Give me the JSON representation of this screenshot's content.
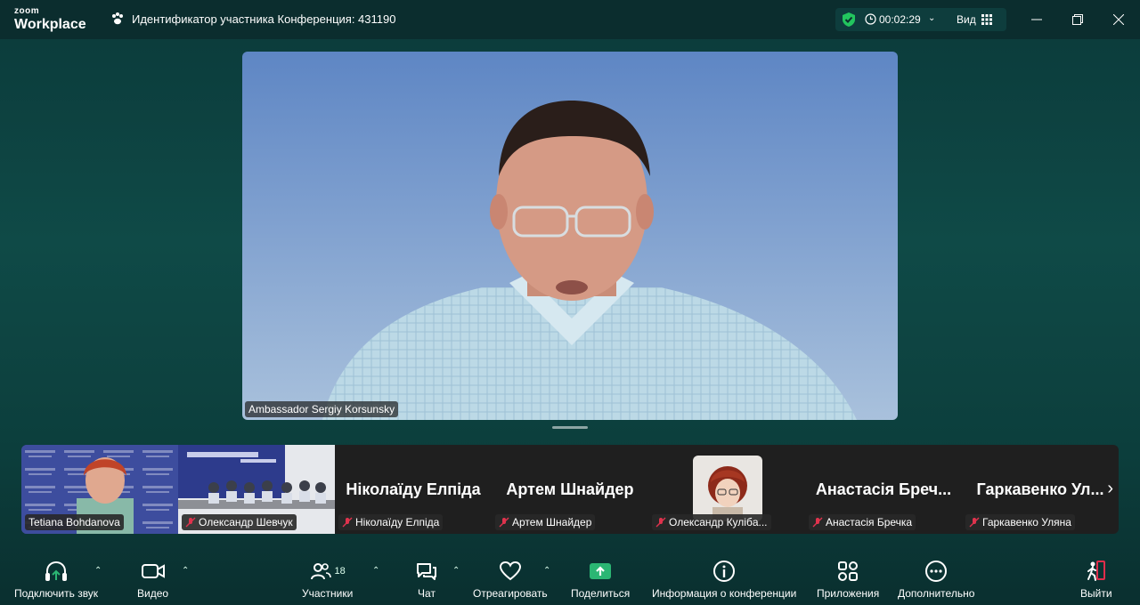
{
  "app": {
    "brand_small": "zoom",
    "brand_large": "Workplace"
  },
  "header": {
    "meeting_id_text": "Идентификатор участника Конференция: 431190",
    "timer": "00:02:29",
    "view_label": "Вид"
  },
  "speaker": {
    "name": "Ambassador Sergiy Korsunsky"
  },
  "participants": [
    {
      "name": "Tetiana Bohdanova",
      "big_name": "",
      "muted": false,
      "type": "video"
    },
    {
      "name": "Олександр Шевчук",
      "big_name": "",
      "muted": true,
      "type": "video"
    },
    {
      "name": "Ніколаїду Елпіда",
      "big_name": "Ніколаїду Елпіда",
      "muted": true,
      "type": "name"
    },
    {
      "name": "Артем Шнайдер",
      "big_name": "Артем Шнайдер",
      "muted": true,
      "type": "name"
    },
    {
      "name": "Олександр Кулібa...",
      "big_name": "",
      "muted": true,
      "type": "avatar"
    },
    {
      "name": "Анастасія Бречка",
      "big_name": "Анастасія Бреч...",
      "muted": true,
      "type": "name"
    },
    {
      "name": "Гаркавенко Уляна",
      "big_name": "Гаркавенко Ул...",
      "muted": true,
      "type": "name"
    }
  ],
  "toolbar": {
    "audio": "Подключить звук",
    "video": "Видео",
    "participants": "Участники",
    "participants_count": "18",
    "chat": "Чат",
    "react": "Отреагировать",
    "share": "Поделиться",
    "info": "Информация о конференции",
    "apps": "Приложения",
    "more": "Дополнительно",
    "leave": "Выйти"
  },
  "colors": {
    "share_green": "#2bb673",
    "leave_red": "#e02d4b",
    "shield_green": "#22c55e"
  }
}
